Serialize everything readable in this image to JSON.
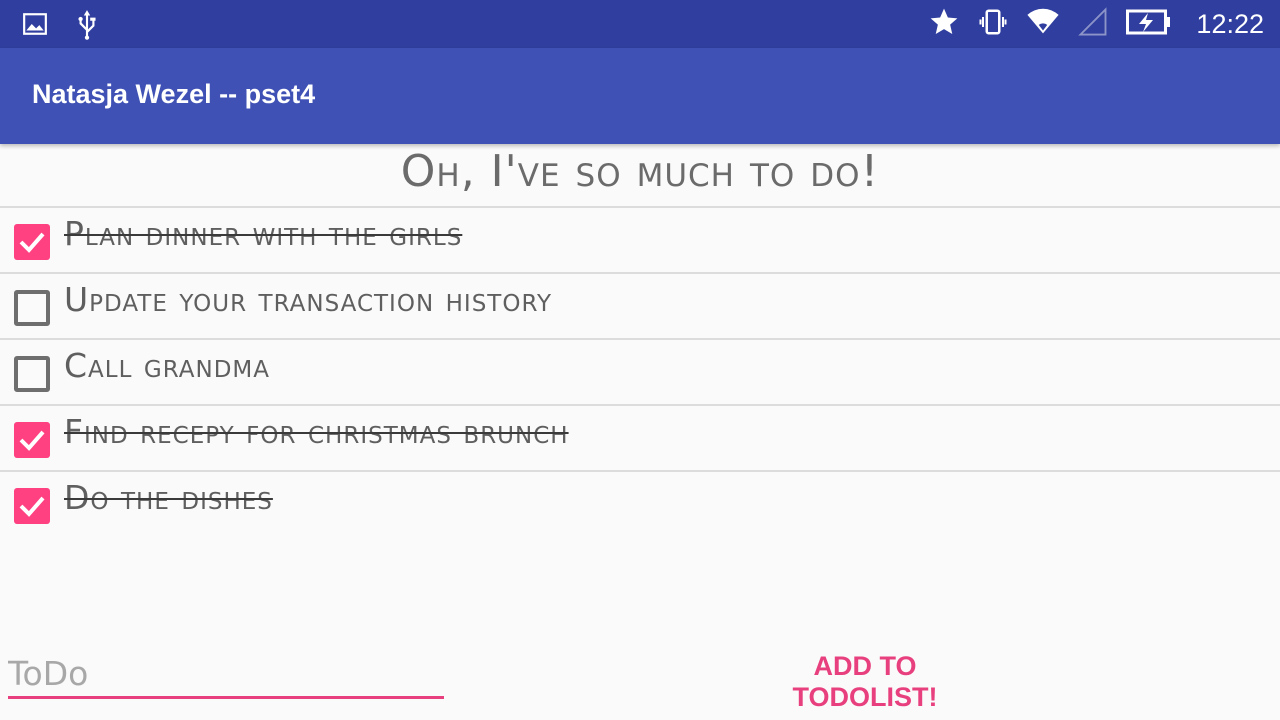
{
  "status_bar": {
    "time": "12:22",
    "left_icons": [
      "image-icon",
      "usb-icon"
    ],
    "right_icons": [
      "star-icon",
      "vibrate-icon",
      "wifi-icon",
      "cell-signal-icon",
      "battery-charging-icon"
    ]
  },
  "app_bar": {
    "title": "Natasja Wezel -- pset4"
  },
  "heading": "Oh, I've so much to do!",
  "todos": [
    {
      "text": "Plan dinner with the girls",
      "checked": true
    },
    {
      "text": "Update your transaction history",
      "checked": false
    },
    {
      "text": "Call grandma",
      "checked": false
    },
    {
      "text": "Find recepy for christmas brunch",
      "checked": true
    },
    {
      "text": "Do the dishes",
      "checked": true
    }
  ],
  "input": {
    "placeholder": "ToDo",
    "value": ""
  },
  "add_button": {
    "label": "ADD TO TODOLIST!"
  },
  "colors": {
    "status_bar": "#303f9f",
    "app_bar": "#3f51b5",
    "accent": "#ff4081"
  }
}
